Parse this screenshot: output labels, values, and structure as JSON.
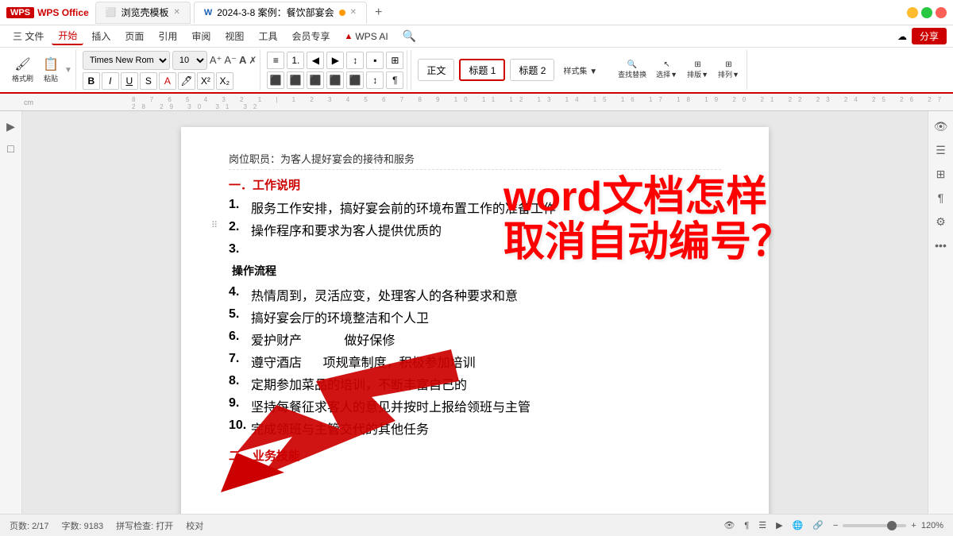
{
  "app": {
    "logo": "WPS Office",
    "logo_icon": "W",
    "template_tab": "浏览壳模板",
    "doc_tab": "2024-3-8 案例：餐饮部宴会",
    "tab_add_label": "+",
    "window_controls": [
      "minimize",
      "maximize",
      "close"
    ]
  },
  "menu": {
    "items": [
      "三 文件",
      "开始",
      "插入",
      "页面",
      "引用",
      "审阅",
      "视图",
      "工具",
      "会员专享",
      "WPS AI"
    ],
    "active": "开始",
    "share_btn": "分享"
  },
  "toolbar": {
    "format_group": "格式刷",
    "paste_group": "粘贴",
    "font_name": "Times New Roma",
    "font_size": "10",
    "bold": "B",
    "italic": "I",
    "underline": "U",
    "styles": [
      "正文",
      "标题 1",
      "标题 2"
    ],
    "style_set": "样式集",
    "find_replace": "查找替换",
    "select": "选择",
    "sort": "排版",
    "sort2": "排列"
  },
  "document": {
    "top_partial": "岗位职员：为客人提好宴会的接待和服务",
    "section1_title": "一．工作说明",
    "items": [
      {
        "num": "1.",
        "text": "服务工作安排，搞好宴会前的环境布置工作的准备工作"
      },
      {
        "num": "2.",
        "text": "操作程序和要求为客人提供优质的"
      },
      {
        "num": "3.",
        "text": ""
      },
      {
        "num": "",
        "text": "操作流程"
      },
      {
        "num": "4.",
        "text": "热情周到，灵活应变，处理客人的各种要求和意"
      },
      {
        "num": "5.",
        "text": "搞好宴会厅的环境整洁和个人卫"
      },
      {
        "num": "6.",
        "text": "爱护财产                  做好保修"
      },
      {
        "num": "7.",
        "text": "遵守酒店            项规章制度，积极参加培训"
      },
      {
        "num": "8.",
        "text": "定期参加菜品的培训，不断丰富自己的"
      },
      {
        "num": "9.",
        "text": "坚持每餐征求客人的意见并按时上报给领班与主管"
      },
      {
        "num": "10.",
        "text": "完成领班与主管交代的其他任务"
      }
    ],
    "section2_title": "二．业务技能"
  },
  "annotation": {
    "line1": "word文档怎样",
    "line2": "取消自动编号？"
  },
  "status_bar": {
    "page": "页数: 2/17",
    "word_count": "字数: 9183",
    "spell_check": "拼写检查: 打开",
    "proofread": "校对",
    "zoom_level": "120%"
  }
}
